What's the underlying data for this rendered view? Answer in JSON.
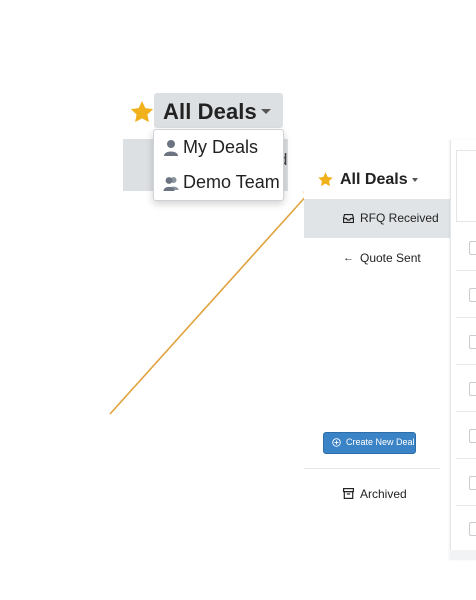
{
  "zoom_callout": {
    "title": "All Deals",
    "hidden_under_text": "d",
    "menu_items": [
      {
        "label": "My Deals",
        "icon": "user-icon"
      },
      {
        "label": "Demo Team",
        "icon": "users-icon"
      }
    ]
  },
  "app": {
    "header_title": "All Deals",
    "nav_items": [
      {
        "label": "RFQ Received",
        "icon": "inbox-icon",
        "active": true
      },
      {
        "label": "Quote Sent",
        "icon": "arrow-left-icon",
        "active": false
      }
    ],
    "create_button_label": "Create New Deal",
    "archived_label": "Archived"
  },
  "colors": {
    "star": "#f1b11c",
    "arrow": "#e0a33f",
    "button": "#3a83c6",
    "active_bg": "#e1e4e7"
  },
  "icons": {
    "arrow_left_glyph": "←"
  }
}
